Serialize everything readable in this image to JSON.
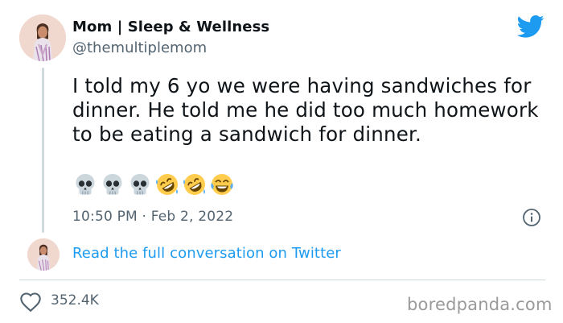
{
  "author": {
    "display_name": "Mom | Sleep & Wellness",
    "handle": "@themultiplemom"
  },
  "tweet": {
    "text": "I told my 6 yo we were having sandwiches for dinner. He told me he did too much homework to be eating a sandwich for dinner.",
    "emojis": [
      "skull-emoji",
      "skull-emoji",
      "skull-emoji",
      "rolling-on-floor-laughing-emoji",
      "rolling-on-floor-laughing-emoji",
      "face-with-tears-of-joy-emoji"
    ],
    "timestamp": "10:50 PM · Feb 2, 2022"
  },
  "conversation": {
    "link_label": "Read the full conversation on Twitter"
  },
  "engagement": {
    "likes": "352.4K"
  },
  "watermark": "boredpanda.com",
  "colors": {
    "twitter_blue": "#1d9bf0",
    "secondary_text": "#536471",
    "primary_text": "#0f1419",
    "divider": "#cfd9de",
    "watermark_gray": "#9a9a9a"
  },
  "icons": {
    "brand": "twitter-bird-icon",
    "info": "info-icon",
    "like": "heart-icon"
  }
}
